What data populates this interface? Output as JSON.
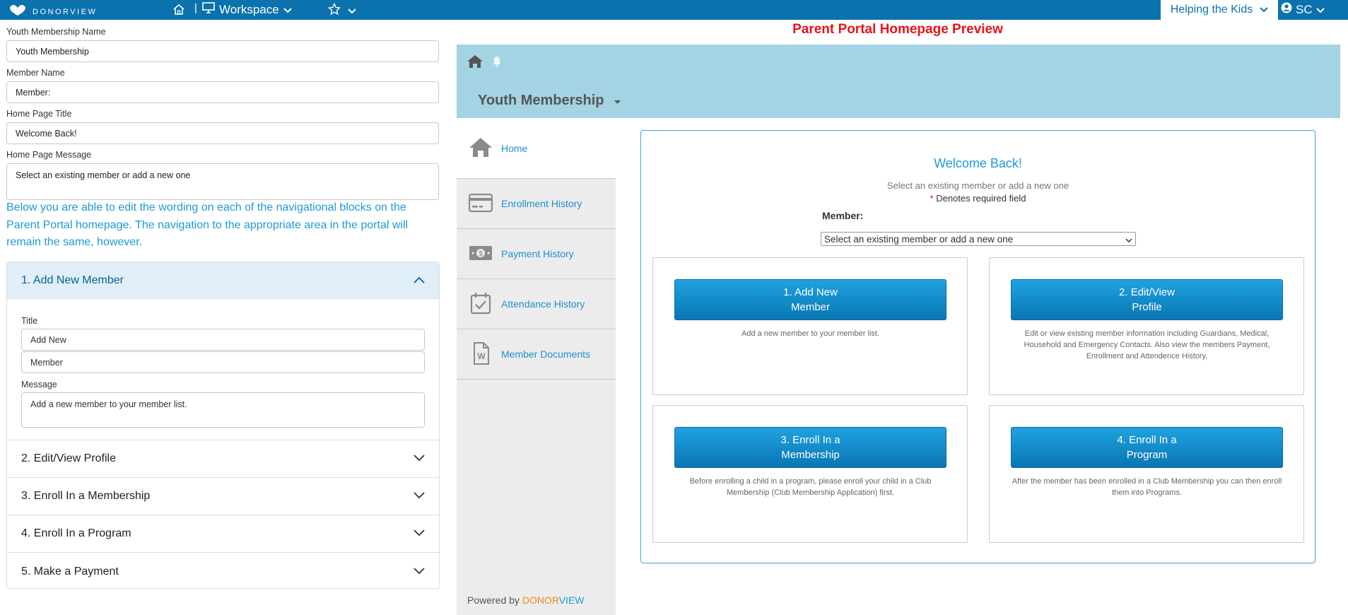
{
  "topbar": {
    "logo_text": "DONORVIEW",
    "workspace_label": "Workspace",
    "org_label": "Helping the Kids",
    "user_initials": "SC",
    "icons": [
      "donorview-logo-icon",
      "home-icon",
      "monitor-icon",
      "chevron-down-icon",
      "star-icon",
      "chevron-down-icon",
      "user-circle-icon",
      "chevron-down-icon"
    ]
  },
  "form": {
    "membership_name_label": "Youth Membership Name",
    "membership_name_value": "Youth Membership",
    "member_name_label": "Member Name",
    "member_name_value": "Member:",
    "home_title_label": "Home Page Title",
    "home_title_value": "Welcome Back!",
    "home_message_label": "Home Page Message",
    "home_message_value": "Select an existing member or add a new one",
    "note": "Below you are able to edit the wording on each of the navigational blocks on the Parent Portal homepage. The navigation to the appropriate area in the portal will remain the same, however."
  },
  "accordion": {
    "open_item": {
      "header": "1. Add New Member",
      "title_label": "Title",
      "title_line1": "Add New",
      "title_line2": "Member",
      "message_label": "Message",
      "message_value": "Add a new member to your member list."
    },
    "items": [
      {
        "label": "2. Edit/View Profile"
      },
      {
        "label": "3. Enroll In a Membership"
      },
      {
        "label": "4. Enroll In a Program"
      },
      {
        "label": "5. Make a Payment"
      }
    ]
  },
  "preview": {
    "heading": "Parent Portal Homepage Preview",
    "header_title": "Youth Membership",
    "nav": [
      {
        "label": "Home",
        "icon": "home-icon"
      },
      {
        "label": "Enrollment History",
        "icon": "credit-card-icon"
      },
      {
        "label": "Payment History",
        "icon": "money-icon"
      },
      {
        "label": "Attendance History",
        "icon": "calendar-check-icon"
      },
      {
        "label": "Member Documents",
        "icon": "document-icon"
      }
    ],
    "powered_by": "Powered by",
    "powered_brand_1": "DONOR",
    "powered_brand_2": "VIEW",
    "welcome_title": "Welcome Back!",
    "welcome_message": "Select an existing member or add a new one",
    "required_star": "*",
    "required_text": "Denotes required field",
    "member_label": "Member:",
    "member_select": "Select an existing member or add a new one",
    "cards": [
      {
        "button": "1. Add New\nMember",
        "desc": "Add a new member to your member list."
      },
      {
        "button": "2. Edit/View\nProfile",
        "desc": "Edit or view existing member information including Guardians, Medical, Household and Emergency Contacts. Also view the members Payment, Enrollment and Attendence History."
      },
      {
        "button": "3. Enroll In a\nMembership",
        "desc": "Before enrolling a child in a program, please enroll your child in a Club Membership (Club Membership Application) first."
      },
      {
        "button": "4. Enroll In a\nProgram",
        "desc": "After the member has been enrolled in a Club Membership you can then enroll them into Programs."
      }
    ]
  },
  "colors": {
    "topbar": "#0b72ad",
    "accent": "#1d9ad6",
    "preview_header": "#a4d3e4",
    "heading_red": "#e8131b",
    "brand_orange": "#f08a1e"
  }
}
